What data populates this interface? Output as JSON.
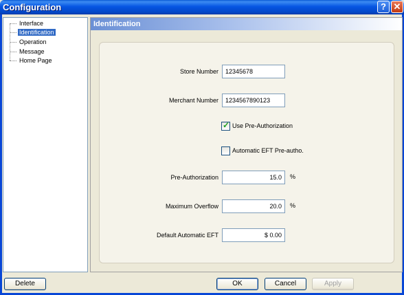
{
  "window": {
    "title": "Configuration",
    "help_glyph": "?",
    "close_glyph": "✕"
  },
  "tree": {
    "items": [
      {
        "label": "Interface",
        "selected": false
      },
      {
        "label": "Identification",
        "selected": true
      },
      {
        "label": "Operation",
        "selected": false
      },
      {
        "label": "Message",
        "selected": false
      },
      {
        "label": "Home Page",
        "selected": false
      }
    ]
  },
  "panel": {
    "title": "Identification",
    "store_number": {
      "label": "Store Number",
      "value": "12345678"
    },
    "merchant_number": {
      "label": "Merchant Number",
      "value": "1234567890123"
    },
    "use_preauth": {
      "label": "Use Pre-Authorization",
      "checked": true
    },
    "auto_eft_preauth": {
      "label": "Automatic EFT Pre-autho.",
      "checked": false
    },
    "pre_authorization": {
      "label": "Pre-Authorization",
      "value": "15.0",
      "unit": "%"
    },
    "maximum_overflow": {
      "label": "Maximum Overflow",
      "value": "20.0",
      "unit": "%"
    },
    "default_auto_eft": {
      "label": "Default Automatic EFT",
      "value": "$ 0.00"
    }
  },
  "buttons": {
    "delete": "Delete",
    "ok": "OK",
    "cancel": "Cancel",
    "apply": "Apply"
  },
  "colors": {
    "titlebar": "#0a5bd6",
    "selection": "#316ac5",
    "panel_header": "#6a8fd5"
  }
}
